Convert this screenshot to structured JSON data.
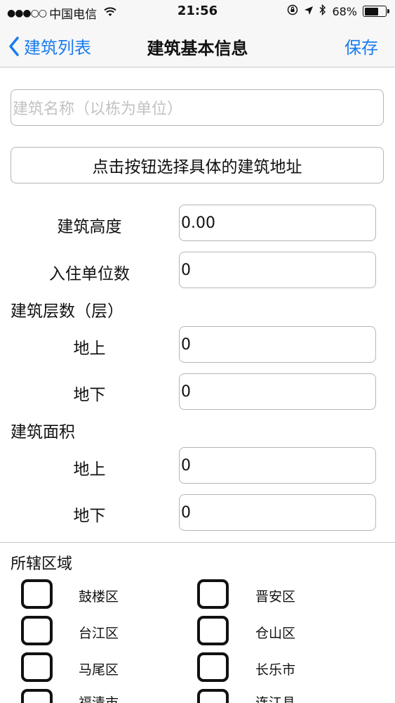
{
  "status_bar": {
    "carrier": "中国电信",
    "signal_dots": "●●●○○",
    "time": "21:56",
    "battery_percent": "68%",
    "battery_level": 0.68
  },
  "nav": {
    "back_label": "建筑列表",
    "title": "建筑基本信息",
    "save_label": "保存"
  },
  "form": {
    "name_placeholder": "建筑名称（以栋为单位）",
    "name_value": "",
    "address_button": "点击按钮选择具体的建筑地址",
    "height_label": "建筑高度",
    "height_value": "0.00",
    "units_label": "入住单位数",
    "units_value": "0",
    "floors_section": "建筑层数（层）",
    "floors_above_label": "地上",
    "floors_above_value": "0",
    "floors_below_label": "地下",
    "floors_below_value": "0",
    "area_section": "建筑面积",
    "area_above_label": "地上",
    "area_above_value": "0",
    "area_below_label": "地下",
    "area_below_value": "0"
  },
  "districts": {
    "section_title": "所辖区域",
    "items": [
      {
        "label": "鼓楼区",
        "checked": false
      },
      {
        "label": "晋安区",
        "checked": false
      },
      {
        "label": "台江区",
        "checked": false
      },
      {
        "label": "仓山区",
        "checked": false
      },
      {
        "label": "马尾区",
        "checked": false
      },
      {
        "label": "长乐市",
        "checked": false
      },
      {
        "label": "福清市",
        "checked": false
      },
      {
        "label": "连江县",
        "checked": false
      }
    ]
  },
  "colors": {
    "accent": "#1a7cf0",
    "bar_background": "#f7f7f7",
    "border": "#b5b5b5"
  }
}
